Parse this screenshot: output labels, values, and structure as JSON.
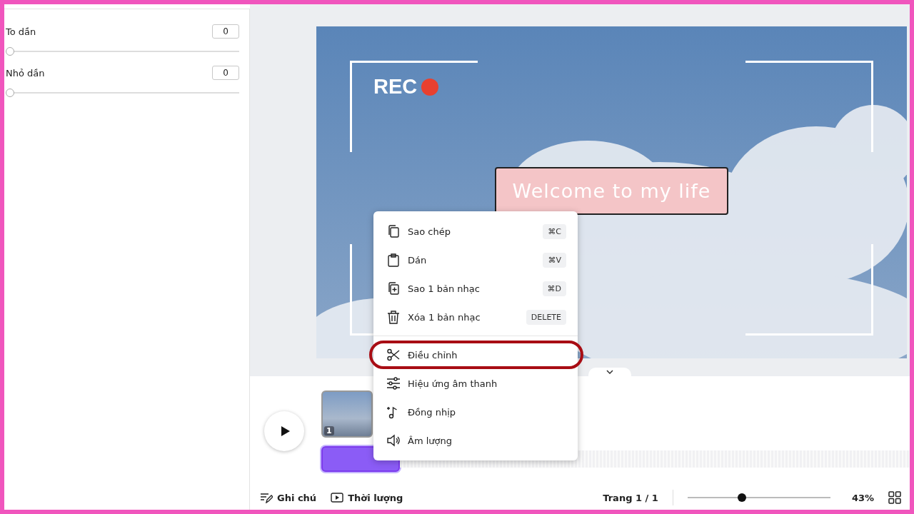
{
  "panel": {
    "effects": [
      {
        "label": "To dần",
        "value": "0",
        "level": 0
      },
      {
        "label": "Nhỏ dần",
        "value": "0",
        "level": 0
      }
    ]
  },
  "canvas": {
    "rec_label": "REC",
    "caption": "Welcome to my life"
  },
  "context_menu": {
    "items": [
      {
        "label": "Sao chép",
        "shortcut": "⌘C",
        "kind": "copy",
        "divider_before": false,
        "highlighted": false
      },
      {
        "label": "Dán",
        "shortcut": "⌘V",
        "kind": "paste",
        "divider_before": false,
        "highlighted": false
      },
      {
        "label": "Sao 1 bản nhạc",
        "shortcut": "⌘D",
        "kind": "duplicate",
        "divider_before": false,
        "highlighted": false
      },
      {
        "label": "Xóa 1 bản nhạc",
        "shortcut": "DELETE",
        "kind": "trash",
        "divider_before": false,
        "highlighted": false
      },
      {
        "label": "Điều chỉnh",
        "kind": "scissors",
        "divider_before": true,
        "highlighted": true
      },
      {
        "label": "Hiệu ứng âm thanh",
        "kind": "sliders",
        "divider_before": false,
        "highlighted": false
      },
      {
        "label": "Đồng nhịp",
        "kind": "note",
        "divider_before": false,
        "highlighted": false
      },
      {
        "label": "Âm lượng",
        "kind": "speaker",
        "divider_before": false,
        "highlighted": false
      }
    ]
  },
  "timeline": {
    "clip_number": "1",
    "audio_track": {
      "selected": true
    }
  },
  "bottom_bar": {
    "notes": "Ghi chú",
    "duration": "Thời lượng",
    "page": "Trang 1 / 1",
    "zoom": {
      "level": 0.375,
      "reading": "43%"
    }
  }
}
